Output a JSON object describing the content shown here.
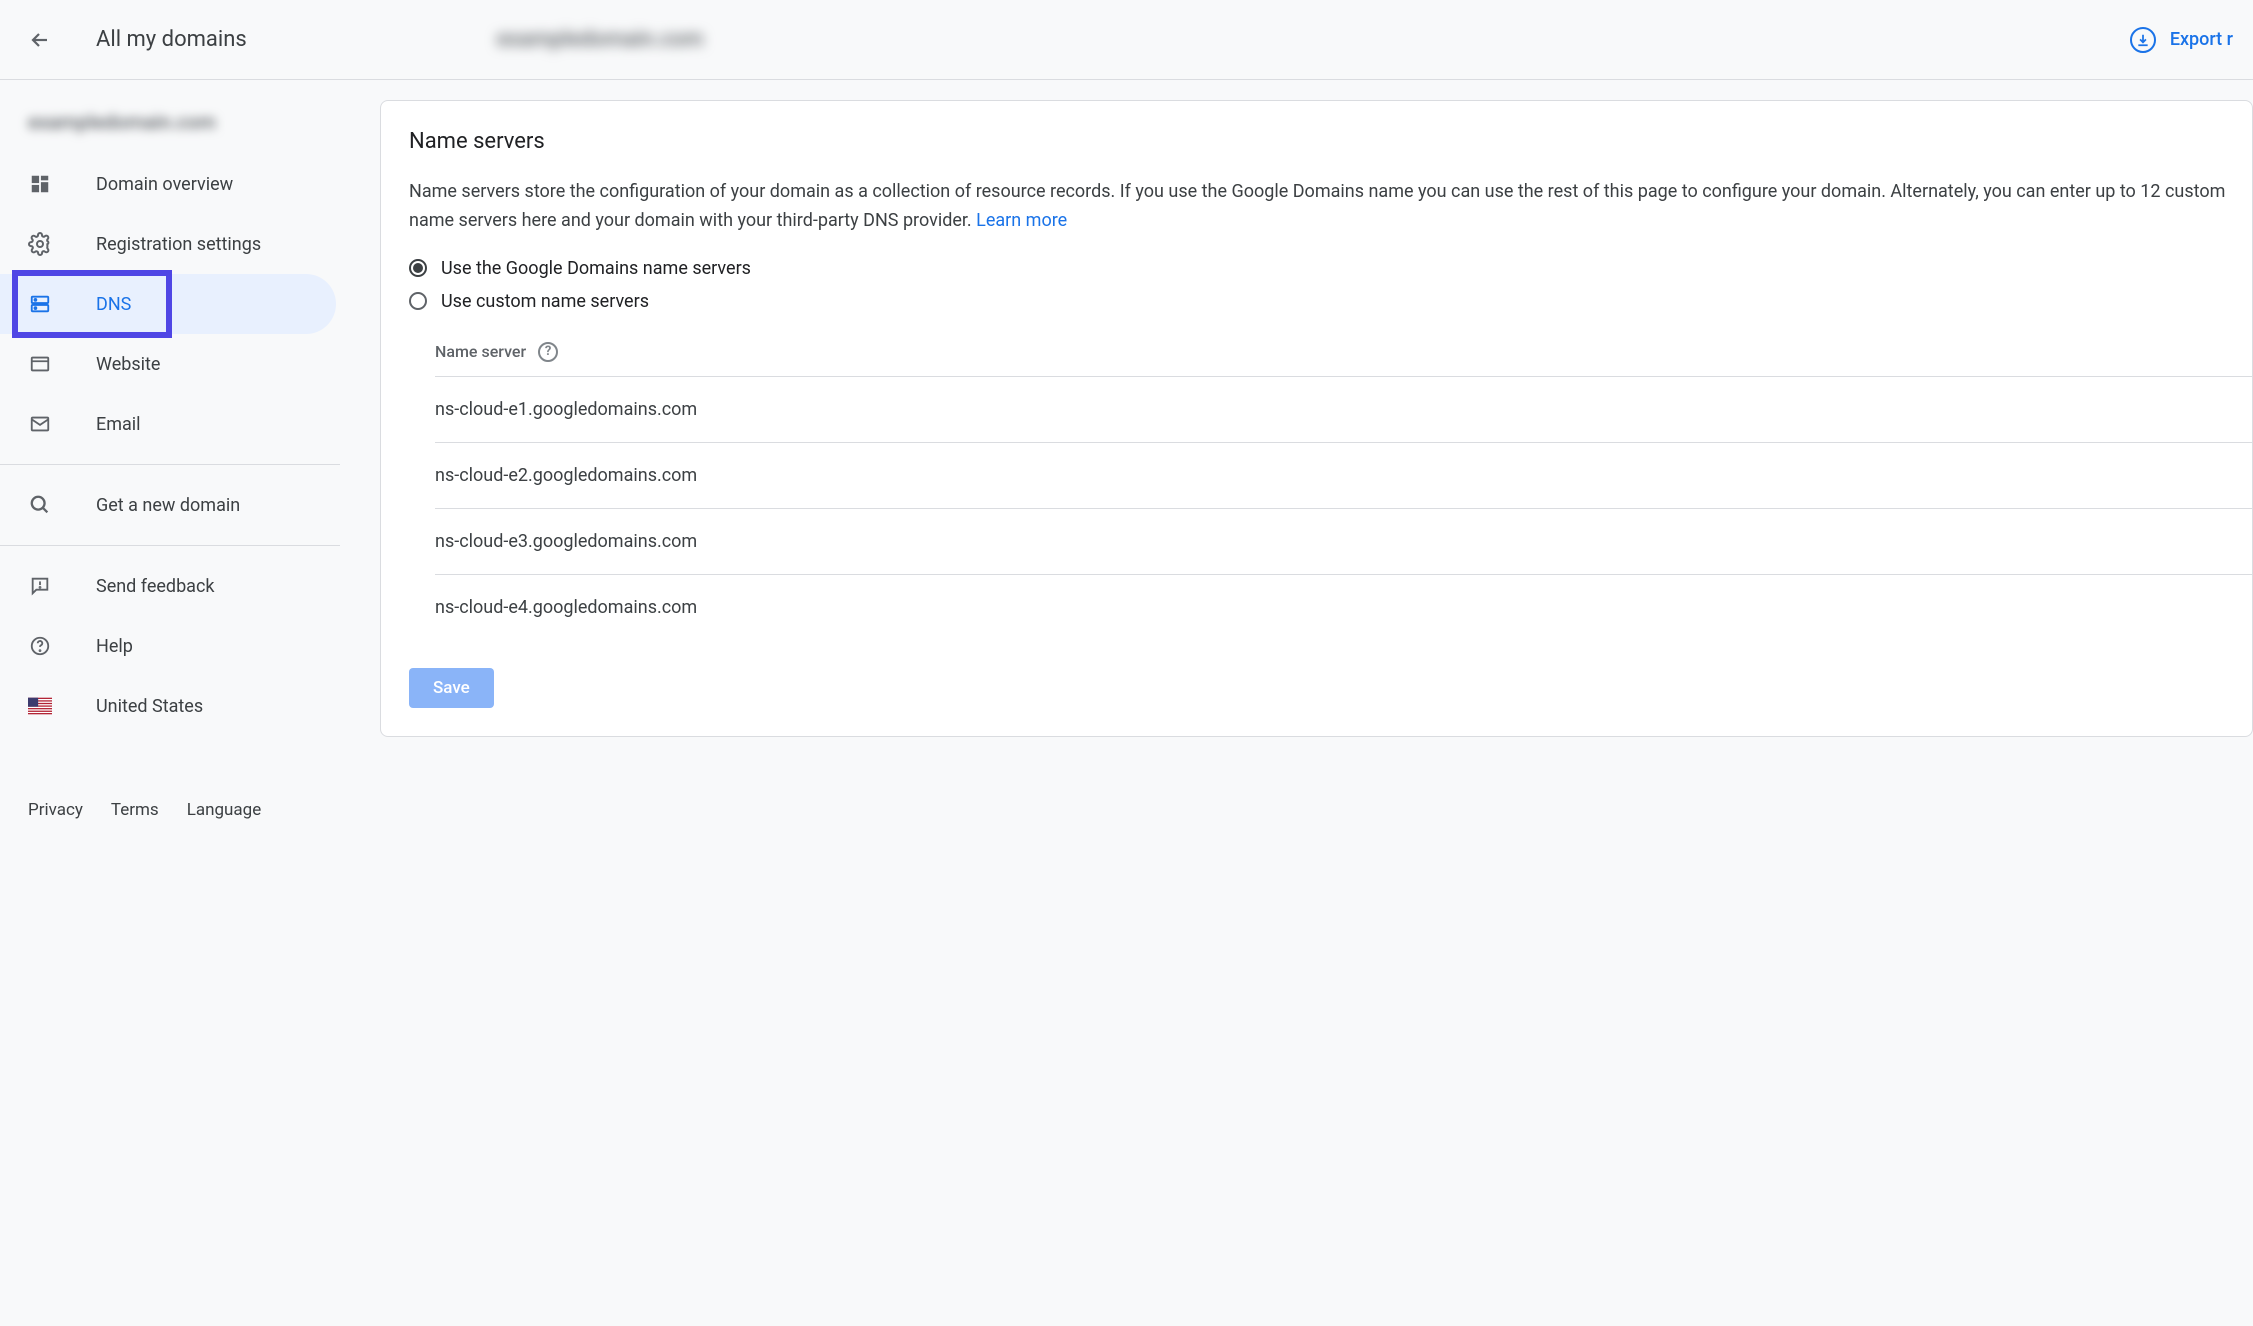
{
  "header": {
    "back_label": "All my domains",
    "domain_name_blurred": "exampledomain.com",
    "export_label": "Export r"
  },
  "sidebar": {
    "domain_name_blurred": "exampledomain.com",
    "items": [
      {
        "label": "Domain overview"
      },
      {
        "label": "Registration settings"
      },
      {
        "label": "DNS"
      },
      {
        "label": "Website"
      },
      {
        "label": "Email"
      }
    ],
    "extra_items": [
      {
        "label": "Get a new domain"
      }
    ],
    "support_items": [
      {
        "label": "Send feedback"
      },
      {
        "label": "Help"
      },
      {
        "label": "United States"
      }
    ],
    "footer": {
      "privacy": "Privacy",
      "terms": "Terms",
      "language": "Language"
    }
  },
  "main": {
    "card_title": "Name servers",
    "card_desc_part1": "Name servers store the configuration of your domain as a collection of resource records. If you use the Google Domains name you can use the rest of this page to configure your domain. Alternately, you can enter up to 12 custom name servers here and your domain with your third-party DNS provider. ",
    "learn_more": "Learn more",
    "radio_google": "Use the Google Domains name servers",
    "radio_custom": "Use custom name servers",
    "ns_header": "Name server",
    "name_servers": [
      "ns-cloud-e1.googledomains.com",
      "ns-cloud-e2.googledomains.com",
      "ns-cloud-e3.googledomains.com",
      "ns-cloud-e4.googledomains.com"
    ],
    "save_label": "Save"
  }
}
